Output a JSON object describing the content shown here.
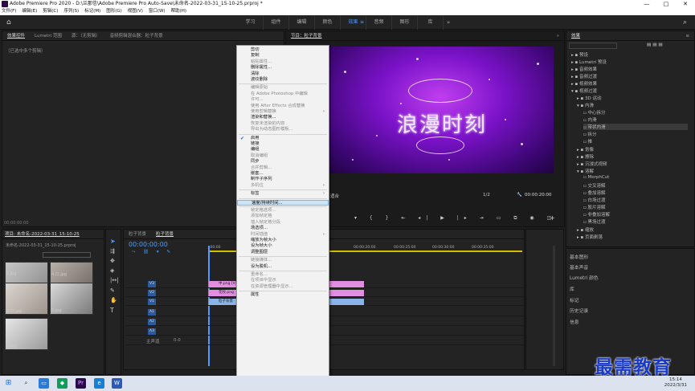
{
  "window": {
    "title": "Adobe Premiere Pro 2020 - D:\\兰那信\\Adobe Premiere Pro Auto-Save\\未命名-2022-03-31_15-10-25.prproj *",
    "controls": [
      "—",
      "□",
      "✕"
    ]
  },
  "menubar": [
    "文件(F)",
    "编辑(E)",
    "剪辑(C)",
    "序列(S)",
    "标记(M)",
    "图形(G)",
    "视图(V)",
    "窗口(W)",
    "帮助(H)"
  ],
  "workspaces": {
    "tabs": [
      "学习",
      "组件",
      "编辑",
      "颜色",
      "效果",
      "音频",
      "图形",
      "库"
    ],
    "active": "效果",
    "more": "»"
  },
  "source_panel": {
    "tabs": [
      "效果控件",
      "Lumetri 范围",
      "源：（无剪辑）",
      "音频剪辑混合器：粒子背景"
    ],
    "message": "（已选中多个剪辑）",
    "timecode": "00:00:00:00"
  },
  "program_panel": {
    "tab": "节目：粒子背景",
    "overlay_title": "浪漫时刻",
    "zoom": "适合",
    "fraction": "1/2",
    "timecode": "00:00:20:00"
  },
  "context_menu": {
    "items": [
      {
        "label": "剪切",
        "enabled": true
      },
      {
        "label": "复制",
        "enabled": true
      },
      {
        "label": "粘贴属性...",
        "enabled": false
      },
      {
        "label": "删除属性...",
        "enabled": true
      },
      {
        "label": "清除",
        "enabled": true
      },
      {
        "label": "波纹删除",
        "enabled": true
      },
      {
        "sep": true
      },
      {
        "label": "编辑原始",
        "enabled": false
      },
      {
        "label": "在 Adobe Photoshop 中编辑",
        "enabled": false
      },
      {
        "label": "许可...",
        "enabled": false
      },
      {
        "label": "使用 After Effects 合成替换",
        "enabled": false
      },
      {
        "label": "使用剪辑替换",
        "enabled": false,
        "submenu": true
      },
      {
        "label": "渲染和替换...",
        "enabled": true
      },
      {
        "label": "恢复未渲染的内容",
        "enabled": false
      },
      {
        "label": "导出为动态图形模板...",
        "enabled": false
      },
      {
        "sep": true
      },
      {
        "label": "启用",
        "enabled": true,
        "checked": true
      },
      {
        "label": "链接",
        "enabled": true
      },
      {
        "label": "编组",
        "enabled": true
      },
      {
        "label": "取消编组",
        "enabled": false
      },
      {
        "label": "同步",
        "enabled": true
      },
      {
        "label": "合并剪辑...",
        "enabled": false
      },
      {
        "label": "嵌套...",
        "enabled": true
      },
      {
        "label": "制作子序列",
        "enabled": true
      },
      {
        "label": "多机位",
        "enabled": false,
        "submenu": true
      },
      {
        "sep": true
      },
      {
        "label": "标签",
        "enabled": true,
        "submenu": true
      },
      {
        "sep": true
      },
      {
        "label": "速度/持续时间...",
        "enabled": true,
        "highlighted": true
      },
      {
        "sep": true
      },
      {
        "label": "帧定格选项...",
        "enabled": false
      },
      {
        "label": "添加帧定格",
        "enabled": false
      },
      {
        "label": "插入帧定格分段",
        "enabled": false
      },
      {
        "label": "场选项...",
        "enabled": true
      },
      {
        "label": "时间插值",
        "enabled": false,
        "submenu": true
      },
      {
        "label": "缩放为帧大小",
        "enabled": true
      },
      {
        "label": "设为帧大小",
        "enabled": true
      },
      {
        "label": "调整图层",
        "enabled": true
      },
      {
        "sep": true
      },
      {
        "label": "链接媒体...",
        "enabled": false
      },
      {
        "label": "设为脱机...",
        "enabled": true
      },
      {
        "sep": true
      },
      {
        "label": "重命名...",
        "enabled": false
      },
      {
        "label": "在项目中显示",
        "enabled": false
      },
      {
        "label": "在资源管理器中显示...",
        "enabled": false
      },
      {
        "sep": true
      },
      {
        "label": "属性",
        "enabled": true
      }
    ]
  },
  "project_panel": {
    "title": "项目: 未命名-2022-03-31_15-10-25",
    "file": "未命名-2022-03-31_15-10-25.prproj",
    "items": [
      "1.jpg",
      "4.口.jpg",
      "2.口.jpg",
      "3.jpg",
      "4.jpg"
    ]
  },
  "timeline": {
    "tabs": [
      "粒子背景",
      "粒子背景"
    ],
    "timecode": "00:00:00:00",
    "ruler": [
      ":00:00",
      "00:00:05:00",
      "00:00:10:00",
      "00:00:15:00",
      "00:00:20:00",
      "00:00:25:00",
      "00:00:30:00",
      "00:00:35:00"
    ],
    "video_tracks": [
      "V3",
      "V2",
      "V1"
    ],
    "audio_tracks": [
      "A1",
      "A2",
      "A3"
    ],
    "master": "主声道",
    "master_value": "0.0",
    "clips": [
      {
        "label": "中.png [V]"
      },
      {
        "label": "花纹.png"
      },
      {
        "label": "粒子背景"
      }
    ]
  },
  "effects_panel": {
    "title": "效果",
    "tree": [
      "预设",
      "Lumetri 预设",
      "音频效果",
      "音频过渡",
      "视频效果",
      "视频过渡",
      "3D 运动",
      "内滑",
      "中心拆分",
      "内滑",
      "带状内滑",
      "拆分",
      "推",
      "划像",
      "擦除",
      "沉浸式视频",
      "溶解",
      "MorphCut",
      "交叉溶解",
      "叠加溶解",
      "白场过渡",
      "胶片溶解",
      "非叠加溶解",
      "黑场过渡",
      "缩放",
      "页面剥落"
    ],
    "selected": "带状内滑"
  },
  "right_panels": [
    "基本图形",
    "基本声音",
    "Lumetri 颜色",
    "库",
    "标记",
    "历史记录",
    "信息"
  ],
  "taskbar": {
    "time": "15:14",
    "date": "2022/3/31"
  },
  "watermark": "最需教育"
}
